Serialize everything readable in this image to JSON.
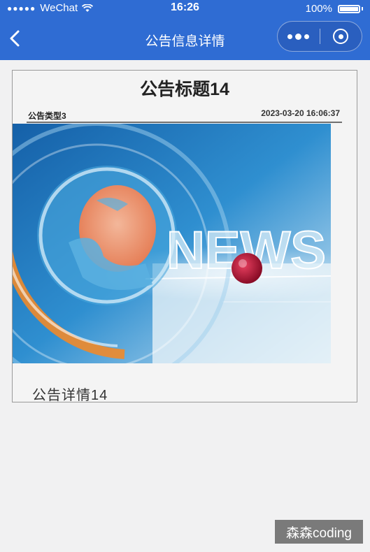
{
  "status_bar": {
    "signal_dots": "●●●●●",
    "carrier": "WeChat",
    "time": "16:26",
    "battery_percent": "100%"
  },
  "nav_bar": {
    "title": "公告信息详情",
    "back_icon": "chevron-left-icon",
    "more_icon": "more-dots-icon",
    "close_icon": "target-circle-icon",
    "color": "#2f6cd3"
  },
  "notice": {
    "title": "公告标题14",
    "type": "公告类型3",
    "datetime": "2023-03-20 16:06:37",
    "image_text": "NEWS",
    "detail": "公告详情14"
  },
  "watermark": {
    "text": "森森coding"
  }
}
